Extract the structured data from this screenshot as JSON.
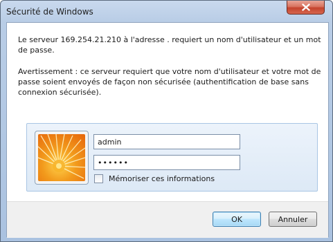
{
  "window": {
    "title": "Sécurité de Windows",
    "close_icon": "close-icon"
  },
  "message": {
    "line1": "Le serveur 169.254.21.210 à l'adresse . requiert un nom d'utilisateur et un mot de passe.",
    "warning": "Avertissement : ce serveur requiert que votre nom d'utilisateur et votre mot de passe soient envoyés de façon non sécurisée (authentification de base sans connexion sécurisée)."
  },
  "credentials": {
    "avatar_icon": "user-tile-flower-icon",
    "username_value": "admin",
    "password_value": "••••••",
    "remember_label": "Mémoriser ces informations",
    "remember_checked": false
  },
  "buttons": {
    "ok_label": "OK",
    "cancel_label": "Annuler"
  },
  "colors": {
    "frame": "#b9cde6",
    "close_button": "#c4432d",
    "panel": "#dde9f6",
    "footer": "#f0f0f0"
  }
}
